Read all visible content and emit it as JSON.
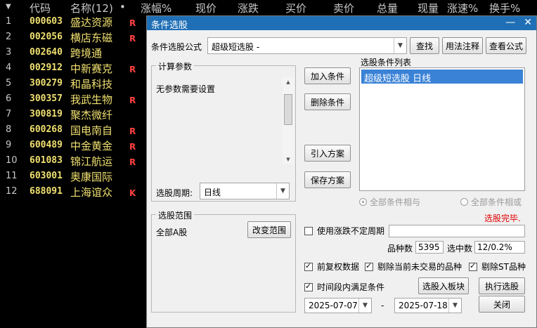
{
  "header": {
    "columns": [
      "代码",
      "名称(12)",
      "•",
      "涨幅%",
      "现价",
      "涨跌",
      "买价",
      "卖价",
      "总量",
      "现量",
      "涨速%",
      "换手%"
    ],
    "dropdown_icon": "▼"
  },
  "stocks": [
    {
      "idx": "1",
      "code": "000603",
      "name": "盛达资源",
      "flag": "R"
    },
    {
      "idx": "2",
      "code": "002056",
      "name": "横店东磁",
      "flag": "R"
    },
    {
      "idx": "3",
      "code": "002640",
      "name": "跨境通",
      "flag": ""
    },
    {
      "idx": "4",
      "code": "002912",
      "name": "中新赛克",
      "flag": "R"
    },
    {
      "idx": "5",
      "code": "300279",
      "name": "和晶科技",
      "flag": ""
    },
    {
      "idx": "6",
      "code": "300357",
      "name": "我武生物",
      "flag": "R"
    },
    {
      "idx": "7",
      "code": "300819",
      "name": "聚杰微纤",
      "flag": ""
    },
    {
      "idx": "8",
      "code": "600268",
      "name": "国电南自",
      "flag": "R"
    },
    {
      "idx": "9",
      "code": "600489",
      "name": "中金黄金",
      "flag": "R"
    },
    {
      "idx": "10",
      "code": "601083",
      "name": "锦江航运",
      "flag": "R"
    },
    {
      "idx": "11",
      "code": "603001",
      "name": "奥康国际",
      "flag": ""
    },
    {
      "idx": "12",
      "code": "688091",
      "name": "上海谊众",
      "flag": "K"
    }
  ],
  "dialog": {
    "title": "条件选股",
    "minimize": "—",
    "close": "✕",
    "formula_label": "条件选股公式",
    "formula_value": "超级短选股  -",
    "find_btn": "查找",
    "usage_btn": "用法注释",
    "view_formula_btn": "查看公式",
    "params_group": "计算参数",
    "params_text": "无参数需要设置",
    "period_label": "选股周期:",
    "period_value": "日线",
    "add_btn": "加入条件",
    "delete_btn": "删除条件",
    "import_btn": "引入方案",
    "save_btn": "保存方案",
    "conditions_label": "选股条件列表",
    "conditions": [
      "超级短选股  日线"
    ],
    "radio_and": "全部条件相与",
    "radio_or": "全部条件相或",
    "status": "选股完毕.",
    "range_group": "选股范围",
    "range_value": "全部A股",
    "change_range_btn": "改变范围",
    "use_period_label": "使用涨跌不定周期",
    "count_label": "品种数",
    "count_value": "5395",
    "selected_label": "选中数",
    "selected_value": "12/0.2%",
    "cb_forward": "前复权数据",
    "cb_exclude_untraded": "剔除当前未交易的品种",
    "cb_exclude_st": "剔除ST品种",
    "cb_in_period": "时间段内满足条件",
    "to_block_btn": "选股入板块",
    "execute_btn": "执行选股",
    "date_from": "2025-07-07",
    "date_sep": "-",
    "date_to": "2025-07-18",
    "close_btn": "关闭"
  }
}
